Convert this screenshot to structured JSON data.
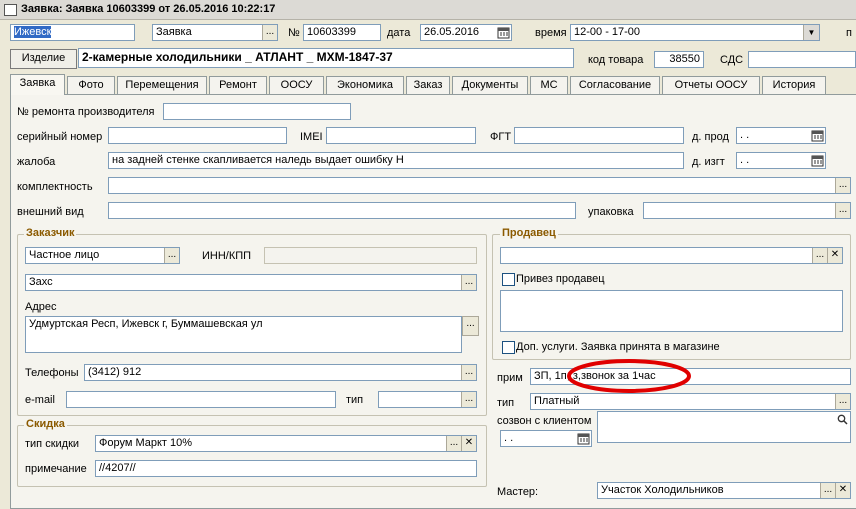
{
  "window": {
    "title": "Заявка: Заявка 10603399 от 26.05.2016 10:22:17"
  },
  "header": {
    "city": "Ижевск",
    "doc_type": "Заявка",
    "num_label": "№",
    "number": "10603399",
    "date_label": "дата",
    "date": "26.05.2016",
    "time_label": "время",
    "time": "12-00 - 17-00",
    "trailing_label": "п",
    "product_button": "Изделие",
    "product": "2-камерные холодильники _ АТЛАНТ _ МХМ-1847-37",
    "product_code_label": "код товара",
    "product_code": "38550",
    "sds_label": "СДС"
  },
  "tabs": [
    "Заявка",
    "Фото",
    "Перемещения",
    "Ремонт",
    "ООСУ",
    "Экономика",
    "Заказ",
    "Документы",
    "МС",
    "Согласование",
    "Отчеты ООСУ",
    "История"
  ],
  "form": {
    "mfr_repair_label": "№ ремонта производителя",
    "serial_label": "серийный номер",
    "imei_label": "IMEI",
    "fgt_label": "ФГТ",
    "prod_date_label": "д. прод",
    "prod_date": " .  .",
    "complaint_label": "жалоба",
    "complaint": "на задней стенке скапливается наледь выдает ошибку Н",
    "mfg_date_label": "д. изгт",
    "mfg_date": " .  .",
    "kit_label": "комплектность",
    "appearance_label": "внешний вид",
    "package_label": "упаковка"
  },
  "customer": {
    "title": "Заказчик",
    "type": "Частное лицо",
    "inn_label": "ИНН/КПП",
    "name": "Захс",
    "address_label": "Адрес",
    "address": "Удмуртская Респ, Ижевск г, Буммашевская ул",
    "phones_label": "Телефоны",
    "phones": "(3412) 912",
    "email_label": "e-mail",
    "tip_label": "тип"
  },
  "discount": {
    "title": "Скидка",
    "type_label": "тип скидки",
    "type": "Форум Маркт 10%",
    "note_label": "примечание",
    "note": "//4207//"
  },
  "seller": {
    "title": "Продавец",
    "brought_label": "Привез продавец",
    "extra_label": "Доп. услуги. Заявка принята в магазине"
  },
  "right": {
    "prim_label": "прим",
    "prim": "ЗП, 1п, з,звонок за 1час",
    "tip_label": "тип",
    "tip": "Платный",
    "call_label": "созвон с клиентом",
    "call_date": " .  .",
    "master_label": "Мастер:",
    "master": "Участок Холодильников"
  },
  "colors": {
    "bg": "#ece9d8",
    "field_border": "#7f9db9",
    "group_title": "#8b5a00",
    "highlight": "#e00000"
  }
}
